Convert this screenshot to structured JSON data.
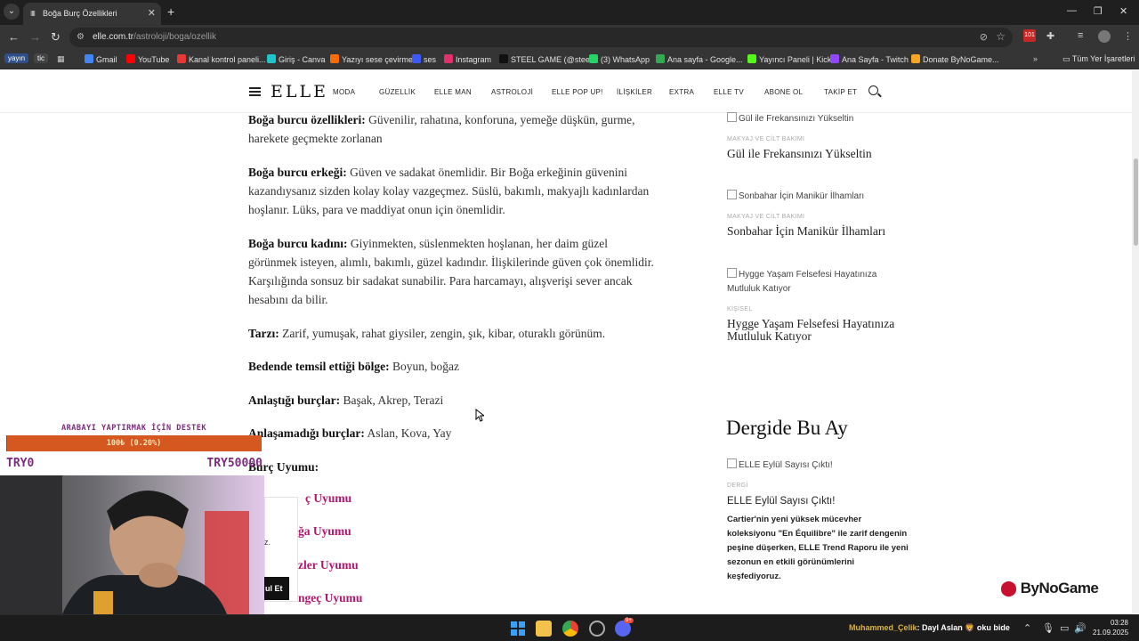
{
  "browser": {
    "tab_title": "Boğa Burç Özellikleri",
    "tab_favicon": "IIII",
    "url_host": "elle.com.tr",
    "url_path": "/astroloji/boga/ozellik",
    "bookmarks": {
      "yayin": "yayın",
      "tic": "tic",
      "items": [
        "Gmail",
        "YouTube",
        "Kanal kontrol paneli...",
        "Giriş - Canva",
        "Yazıyı sese çevirme",
        "ses",
        "Instagram",
        "STEEL GAME (@stee...",
        "(3) WhatsApp",
        "Ana sayfa - Google...",
        "Yayıncı Paneli | Kick",
        "Ana Sayfa - Twitch",
        "Donate ByNoGame..."
      ],
      "all": "Tüm Yer İşaretleri",
      "colors": [
        "#4285f4",
        "#ff0000",
        "#e53935",
        "#20c4cb",
        "#ff6d00",
        "#3c5afe",
        "#e1306c",
        "#111111",
        "#25d366",
        "#34a853",
        "#53fc18",
        "#9146ff",
        "#f5a623"
      ]
    }
  },
  "site": {
    "logo": "ELLE",
    "nav": [
      "MODA",
      "GÜZELLİK",
      "ELLE MAN",
      "ASTROLOJİ",
      "ELLE POP UP!",
      "İLİŞKİLER",
      "EXTRA",
      "ELLE TV",
      "ABONE OL",
      "TAKİP ET"
    ]
  },
  "article": {
    "p1_label": "Boğa burcu özellikleri:",
    "p1_text": " Güvenilir, rahatına, konforuna, yemeğe düşkün, gurme, harekete geçmekte zorlanan",
    "p2_label": "Boğa burcu erkeği:",
    "p2_text": " Güven ve sadakat önemlidir. Bir Boğa erkeğinin güvenini kazandıysanız sizden kolay kolay vazgeçmez. Süslü, bakımlı, makyajlı kadınlardan hoşlanır. Lüks, para ve maddiyat onun için önemlidir.",
    "p3_label": "Boğa burcu kadını:",
    "p3_text": " Giyinmekten, süslenmekten hoşlanan, her daim güzel görünmek isteyen, alımlı, bakımlı, güzel kadındır. İlişkilerinde güven çok önemlidir. Karşılığında sonsuz bir sadakat sunabilir. Para harcamayı, alışverişi sever ancak hesabını da bilir.",
    "p4_label": "Tarzı:",
    "p4_text": " Zarif, yumuşak, rahat giysiler, zengin, şık, kibar, oturaklı görünüm.",
    "p5_label": "Bedende temsil ettiği bölge:",
    "p5_text": " Boyun, boğaz",
    "p6_label": "Anlaştığı burçlar:",
    "p6_text": " Başak, Akrep, Terazi",
    "p7_label": "Anlaşamadığı burçlar:",
    "p7_text": " Aslan, Kova, Yay",
    "p8_label": "Burç Uyumu:",
    "links": [
      "ç Uyumu",
      "ğa Uyumu",
      "zler Uyumu",
      "ngeç Uyumu"
    ]
  },
  "sidebar": {
    "items": [
      {
        "img_alt": "Gül ile Frekansınızı Yükseltin",
        "category": "",
        "title": "Gül ile Frekansınızı Yükseltin"
      },
      {
        "img_alt": "Sonbahar İçin Manikür İlhamları",
        "category": "MAKYAJ VE CİLT BAKIMI",
        "title": "Sonbahar İçin Manikür İlhamları"
      },
      {
        "img_alt": "Hygge Yaşam Felsefesi Hayatınıza Mutluluk Katıyor",
        "category": "KİŞİSEL",
        "title": "Hygge Yaşam Felsefesi Hayatınıza Mutluluk Katıyor"
      }
    ],
    "first_category": "MAKYAJ VE CİLT BAKIMI",
    "section_title": "Dergide Bu Ay",
    "mag_img_alt": "ELLE Eylül Sayısı Çıktı!",
    "mag_category": "DERGİ",
    "mag_title": "ELLE Eylül Sayısı Çıktı!",
    "mag_desc": "Cartier'nin yeni yüksek mücevher koleksiyonu \"En Équilibre\" ile zarif dengenin peşine düşerken, ELLE Trend Raporu ile yeni sezonun en etkili görünümlerini keşfediyoruz."
  },
  "overlay": {
    "donation_title": "ARABAYI YAPTIRMAK İÇİN DESTEK",
    "donation_progress": "100₺ (0.20%)",
    "donation_fraction": 0.002,
    "donation_min": "TRY0",
    "donation_max": "TRY50000",
    "popup_text": "z.",
    "popup_button": "ul Et",
    "sponsor": "ByNoGame"
  },
  "taskbar": {
    "chat_user": "Muhammed_Çelik",
    "chat_msg": ": Dayl Aslan 🦁 oku bide",
    "time": "03:28",
    "date": "21.09.2025",
    "badge": "9+"
  }
}
